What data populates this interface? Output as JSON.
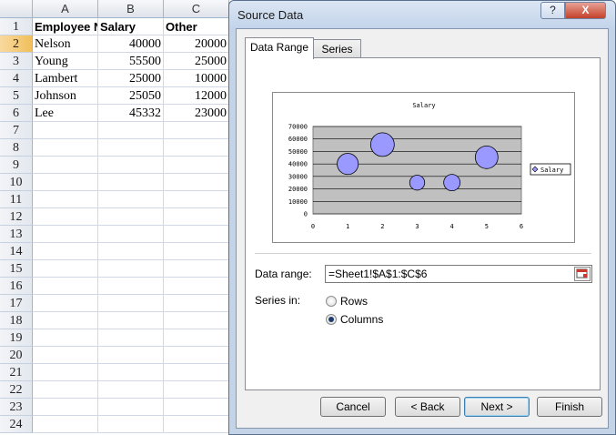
{
  "spreadsheet": {
    "columns": [
      "A",
      "B",
      "C"
    ],
    "rows": [
      "1",
      "2",
      "3",
      "4",
      "5",
      "6",
      "7",
      "8",
      "9",
      "10",
      "11",
      "12",
      "13",
      "14",
      "15",
      "16",
      "17",
      "18",
      "19",
      "20",
      "21",
      "22",
      "23",
      "24"
    ],
    "active_row": "2",
    "cells": {
      "header": [
        "Employee N",
        "Salary",
        "Other"
      ],
      "r2": [
        "Nelson",
        "40000",
        "20000"
      ],
      "r3": [
        "Young",
        "55500",
        "25000"
      ],
      "r4": [
        "Lambert",
        "25000",
        "10000"
      ],
      "r5": [
        "Johnson",
        "25050",
        "12000"
      ],
      "r6": [
        "Lee",
        "45332",
        "23000"
      ]
    }
  },
  "dialog": {
    "title": "Source Data",
    "help_label": "?",
    "close_label": "X",
    "tabs": [
      "Data Range",
      "Series"
    ],
    "data_range_label": "Data range:",
    "data_range_value": "=Sheet1!$A$1:$C$6",
    "series_in_label": "Series in:",
    "series_in_options": [
      "Rows",
      "Columns"
    ],
    "series_in_selected": "Columns",
    "buttons": {
      "cancel": "Cancel",
      "back": "< Back",
      "next": "Next >",
      "finish": "Finish"
    }
  },
  "chart_data": {
    "type": "scatter",
    "title": "Salary",
    "series": [
      {
        "name": "Salary",
        "x": [
          1,
          2,
          3,
          4,
          5
        ],
        "y": [
          40000,
          55500,
          25000,
          25050,
          45332
        ],
        "size": [
          20000,
          25000,
          10000,
          12000,
          23000
        ]
      }
    ],
    "x_ticks": [
      "0",
      "1",
      "2",
      "3",
      "4",
      "5",
      "6"
    ],
    "y_ticks": [
      "0",
      "10000",
      "20000",
      "30000",
      "40000",
      "50000",
      "60000",
      "70000"
    ],
    "xlim": [
      0,
      6
    ],
    "ylim": [
      0,
      70000
    ],
    "grid": true,
    "legend_position": "right",
    "colors": {
      "bubble_fill": "#9999ff",
      "plot_area": "#c0c0c0",
      "bubble_stroke": "#000000"
    }
  }
}
